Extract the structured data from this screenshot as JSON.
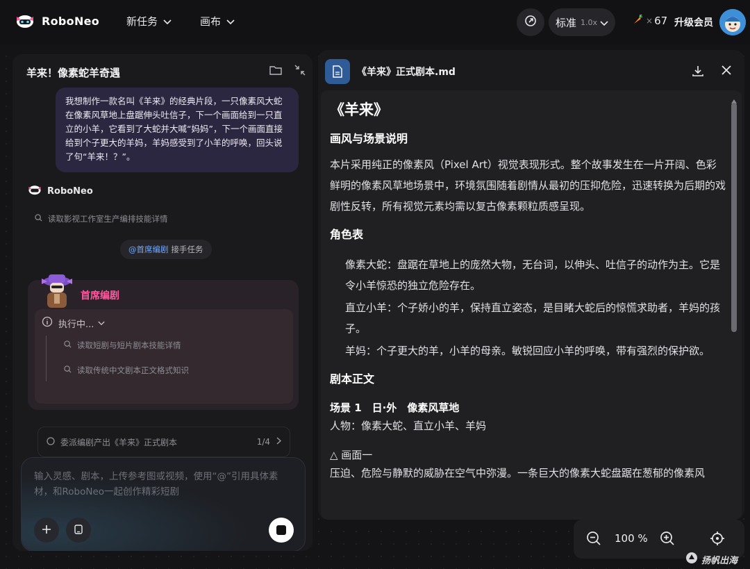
{
  "app": {
    "name": "RoboNeo",
    "brand_color": "#ff5aa0"
  },
  "topbar": {
    "new_task_label": "新任务",
    "canvas_label": "画布",
    "mode_label": "标准",
    "mode_speed": "1.0x",
    "credits_count": "67",
    "credits_multiplier": "×",
    "upgrade_label": "升级会员"
  },
  "left_panel": {
    "title": "羊来！像素蛇羊奇遇",
    "user_message": "我想制作一款名叫《羊来》的经典片段，一只像素风大蛇在像素风草地上盘踞伸头吐信子，下一个画面给到一只直立的小羊，它看到了大蛇并大喊“妈妈”，下一个画面直接给到个子更大的羊妈，羊妈感受到了小羊的呼唤，回头说了句“羊来！？”。",
    "bot_name": "RoboNeo",
    "tool_read_1": "读取影视工作室生产编排技能详情",
    "handoff_mention": "@首席编剧",
    "handoff_text": "接手任务",
    "agent_name": "首席编剧",
    "exec_status": "执行中...",
    "exec_step_1": "读取短剧与短片剧本技能详情",
    "exec_step_2": "读取传统中文剧本正文格式知识",
    "task_text": "委派编剧产出《羊来》正式剧本",
    "task_page": "1/4",
    "composer_placeholder": "输入灵感、剧本，上传参考图或视频，使用“@”引用具体素材，和RoboNeo一起创作精彩短剧"
  },
  "document": {
    "filename": "《羊来》正式剧本.md",
    "title": "《羊来》",
    "h_style": "画风与场景说明",
    "p_style": "本片采用纯正的像素风（Pixel Art）视觉表现形式。整个故事发生在一片开阔、色彩鲜明的像素风草地场景中，环境氛围随着剧情从最初的压抑危险，迅速转换为后期的戏剧性反转，所有视觉元素均需以复古像素颗粒质感呈现。",
    "h_roles": "角色表",
    "role_snake": "像素大蛇：盘踞在草地上的庞然大物，无台词，以伸头、吐信子的动作为主。它是令小羊惊恐的独立危险存在。",
    "role_lamb": "直立小羊：个子娇小的羊，保持直立姿态，是目睹大蛇后的惊慌求助者，羊妈的孩子。",
    "role_mom": "羊妈：个子更大的羊，小羊的母亲。敏锐回应小羊的呼唤，带有强烈的保护欲。",
    "h_script": "剧本正文",
    "scene_1": "场景 1　日·外　像素风草地",
    "scene_1_chars": "人物：像素大蛇、直立小羊、羊妈",
    "frame_1": "△ 画面一",
    "frame_1_text": "压迫、危险与静默的威胁在空气中弥漫。一条巨大的像素大蛇盘踞在葱郁的像素风"
  },
  "zoom": {
    "level": "100 %"
  },
  "watermark": {
    "text": "扬帆出海"
  }
}
